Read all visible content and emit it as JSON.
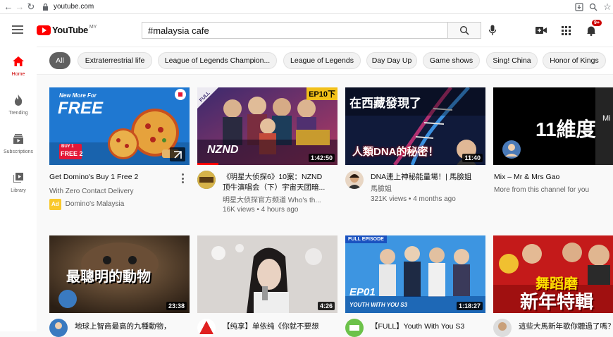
{
  "browser": {
    "url": "youtube.com"
  },
  "header": {
    "logo_text": "YouTube",
    "country": "MY",
    "search_value": "#malaysia cafe",
    "notification_count": "9+"
  },
  "sidebar": {
    "items": [
      {
        "label": "Home"
      },
      {
        "label": "Trending"
      },
      {
        "label": "Subscriptions"
      },
      {
        "label": "Library"
      }
    ]
  },
  "chips": [
    {
      "label": "All"
    },
    {
      "label": "Extraterrestrial life"
    },
    {
      "label": "League of Legends Champion..."
    },
    {
      "label": "League of Legends"
    },
    {
      "label": "Day Day Up"
    },
    {
      "label": "Game shows"
    },
    {
      "label": "Sing! China"
    },
    {
      "label": "Honor of Kings"
    }
  ],
  "videos": [
    {
      "title": "Get Domino's Buy 1 Free 2",
      "line2": "With Zero Contact Delivery",
      "ad_label": "Ad",
      "channel": "Domino's Malaysia",
      "thumb_text": {
        "a": "New More For",
        "b": "FREE",
        "c": "BUY 1",
        "d": "FREE 2"
      }
    },
    {
      "title": "《明星大侦探6》10案：NZND",
      "title2": "顶牛演唱会（下）宇宙天团暗...",
      "channel": "明星大侦探官方频道 Who's th...",
      "meta": "16K views • 4 hours ago",
      "duration": "1:42:50",
      "thumb_text": {
        "a": "EP10下",
        "b": "FULL",
        "c": "NZND"
      }
    },
    {
      "title": "DNA連上神秘能量場！| 馬臉姐",
      "channel": "馬臉姐",
      "meta": "321K views • 4 months ago",
      "duration": "11:40",
      "thumb_text": {
        "a": "在西藏發現了",
        "b": "人類DNA的秘密！"
      }
    },
    {
      "title": "Mix – Mr & Mrs Gao",
      "channel": "More from this channel for you",
      "thumb_text": {
        "a": "11維度",
        "b": "Mi"
      }
    },
    {
      "title": "地球上智商最高的九種動物，",
      "duration": "23:38",
      "thumb_text": {
        "a": "最聰明的動物"
      }
    },
    {
      "title": "【纯享】单依纯《你就不要想",
      "duration": "4:26",
      "thumb_text": {}
    },
    {
      "title": "【FULL】Youth With You S3",
      "duration": "1:18:27",
      "thumb_text": {
        "a": "FULL EPISODE",
        "b": "EP01",
        "c": "YOUTH WITH YOU S3"
      }
    },
    {
      "title": "這些大馬新年歌你聽過了嗎？",
      "thumb_text": {
        "a": "舞蹈磨",
        "b": "新年特輯"
      }
    }
  ]
}
